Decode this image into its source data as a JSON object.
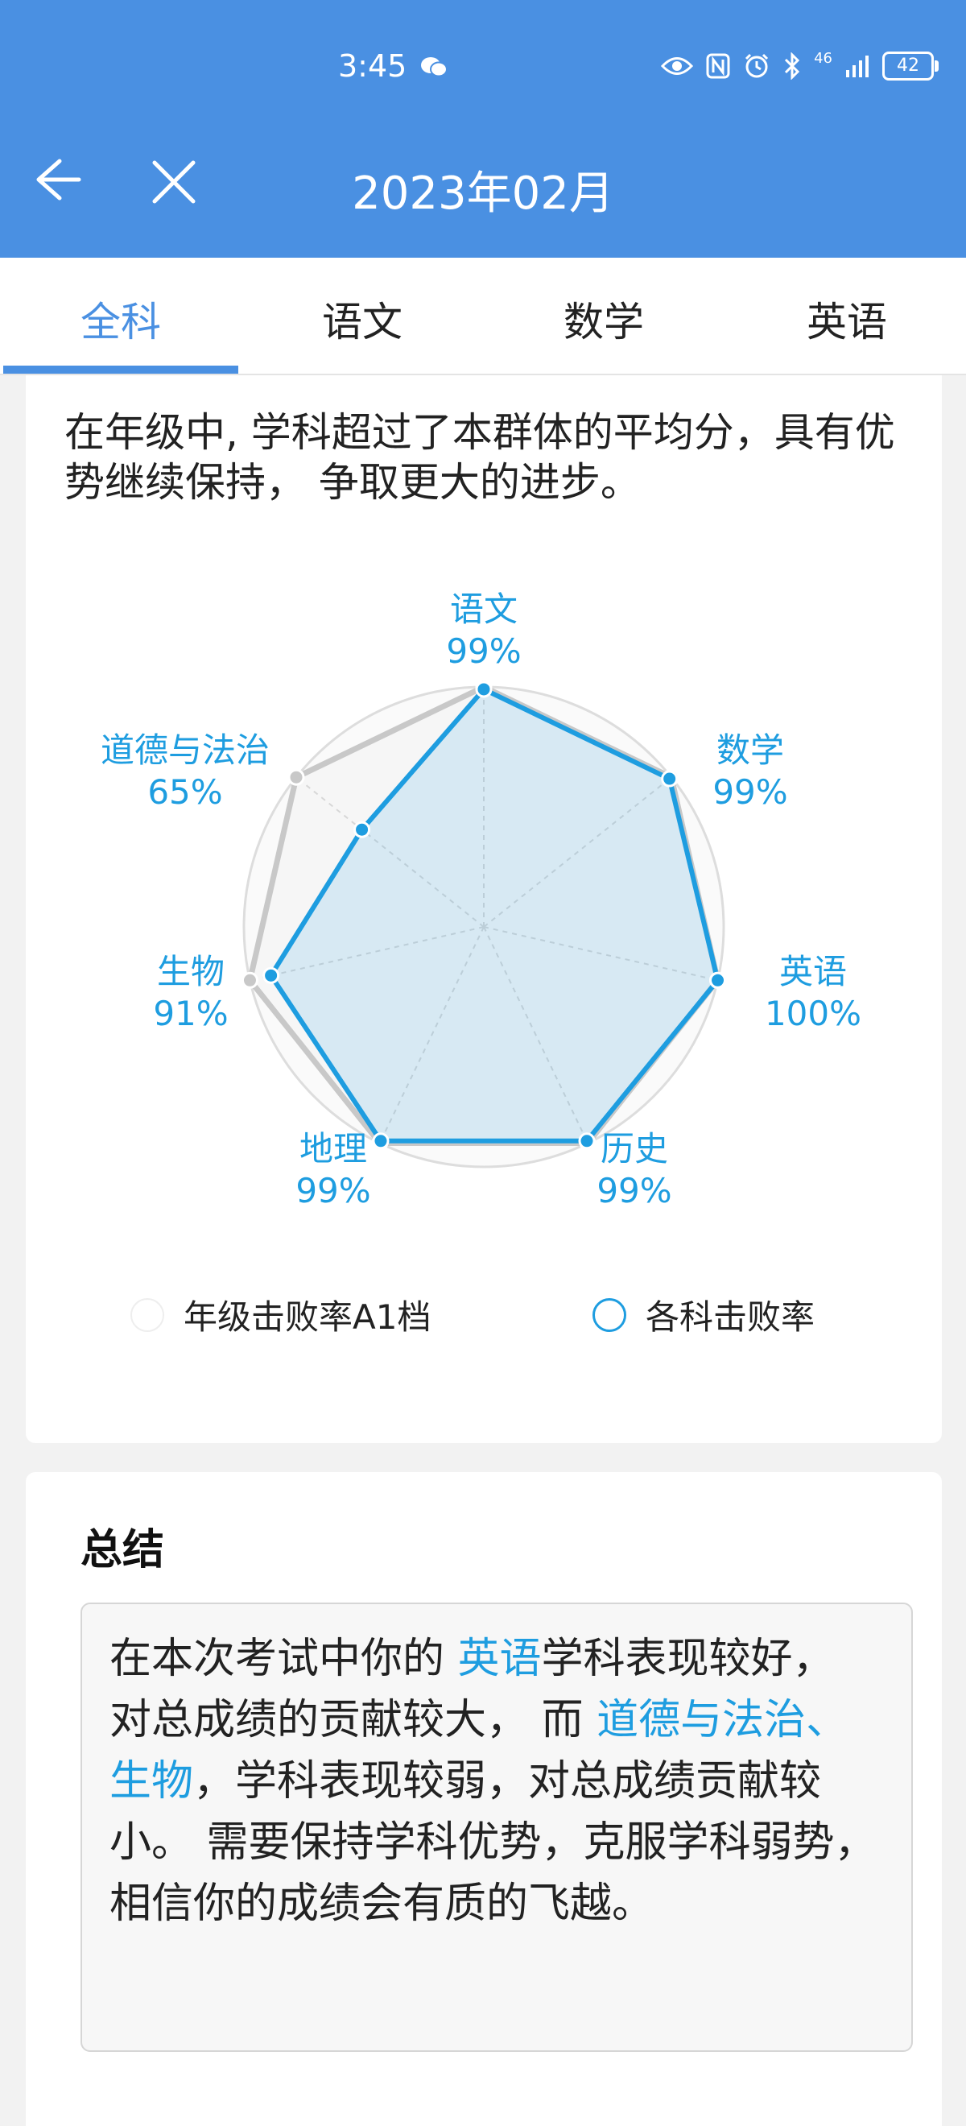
{
  "status_bar": {
    "time": "3:45",
    "network": "46",
    "battery": "42"
  },
  "nav": {
    "title": "2023年02月"
  },
  "tabs": [
    {
      "label": "全科",
      "active": true
    },
    {
      "label": "语文",
      "active": false
    },
    {
      "label": "数学",
      "active": false
    },
    {
      "label": "英语",
      "active": false
    }
  ],
  "analysis": {
    "description": "在年级中, 学科超过了本群体的平均分，具有优势继续保持， 争取更大的进步。"
  },
  "chart_data": {
    "type": "radar",
    "axes": [
      "语文",
      "数学",
      "英语",
      "历史",
      "地理",
      "生物",
      "道德与法治"
    ],
    "axis_values": [
      "99%",
      "99%",
      "100%",
      "99%",
      "99%",
      "91%",
      "65%"
    ],
    "series": [
      {
        "name": "年级击败率A1档",
        "values": [
          100,
          100,
          100,
          100,
          100,
          100,
          100
        ],
        "color": "#c8c8c8"
      },
      {
        "name": "各科击败率",
        "values": [
          99,
          99,
          100,
          99,
          99,
          91,
          65
        ],
        "color": "#1e9de0"
      }
    ],
    "range": [
      0,
      100
    ],
    "rings": 4,
    "legend_position": "bottom"
  },
  "legend": [
    {
      "label": "年级击败率A1档",
      "color": "#ffffff"
    },
    {
      "label": "各科击败率",
      "color": "#1e9de0"
    }
  ],
  "summary": {
    "title": "总结",
    "p1": "在本次考试中你的 ",
    "strong_subject": "英语",
    "p2": "学科表现较好， 对总成绩的贡献较大， 而 ",
    "weak_subjects": "道德与法治、生物",
    "p3": "，学科表现较弱，对总成绩贡献较小。 需要保持学科优势，克服学科弱势，相信你的成绩会有质的飞越。"
  },
  "colors": {
    "header": "#4a90e2",
    "accent": "#1e9de0"
  }
}
